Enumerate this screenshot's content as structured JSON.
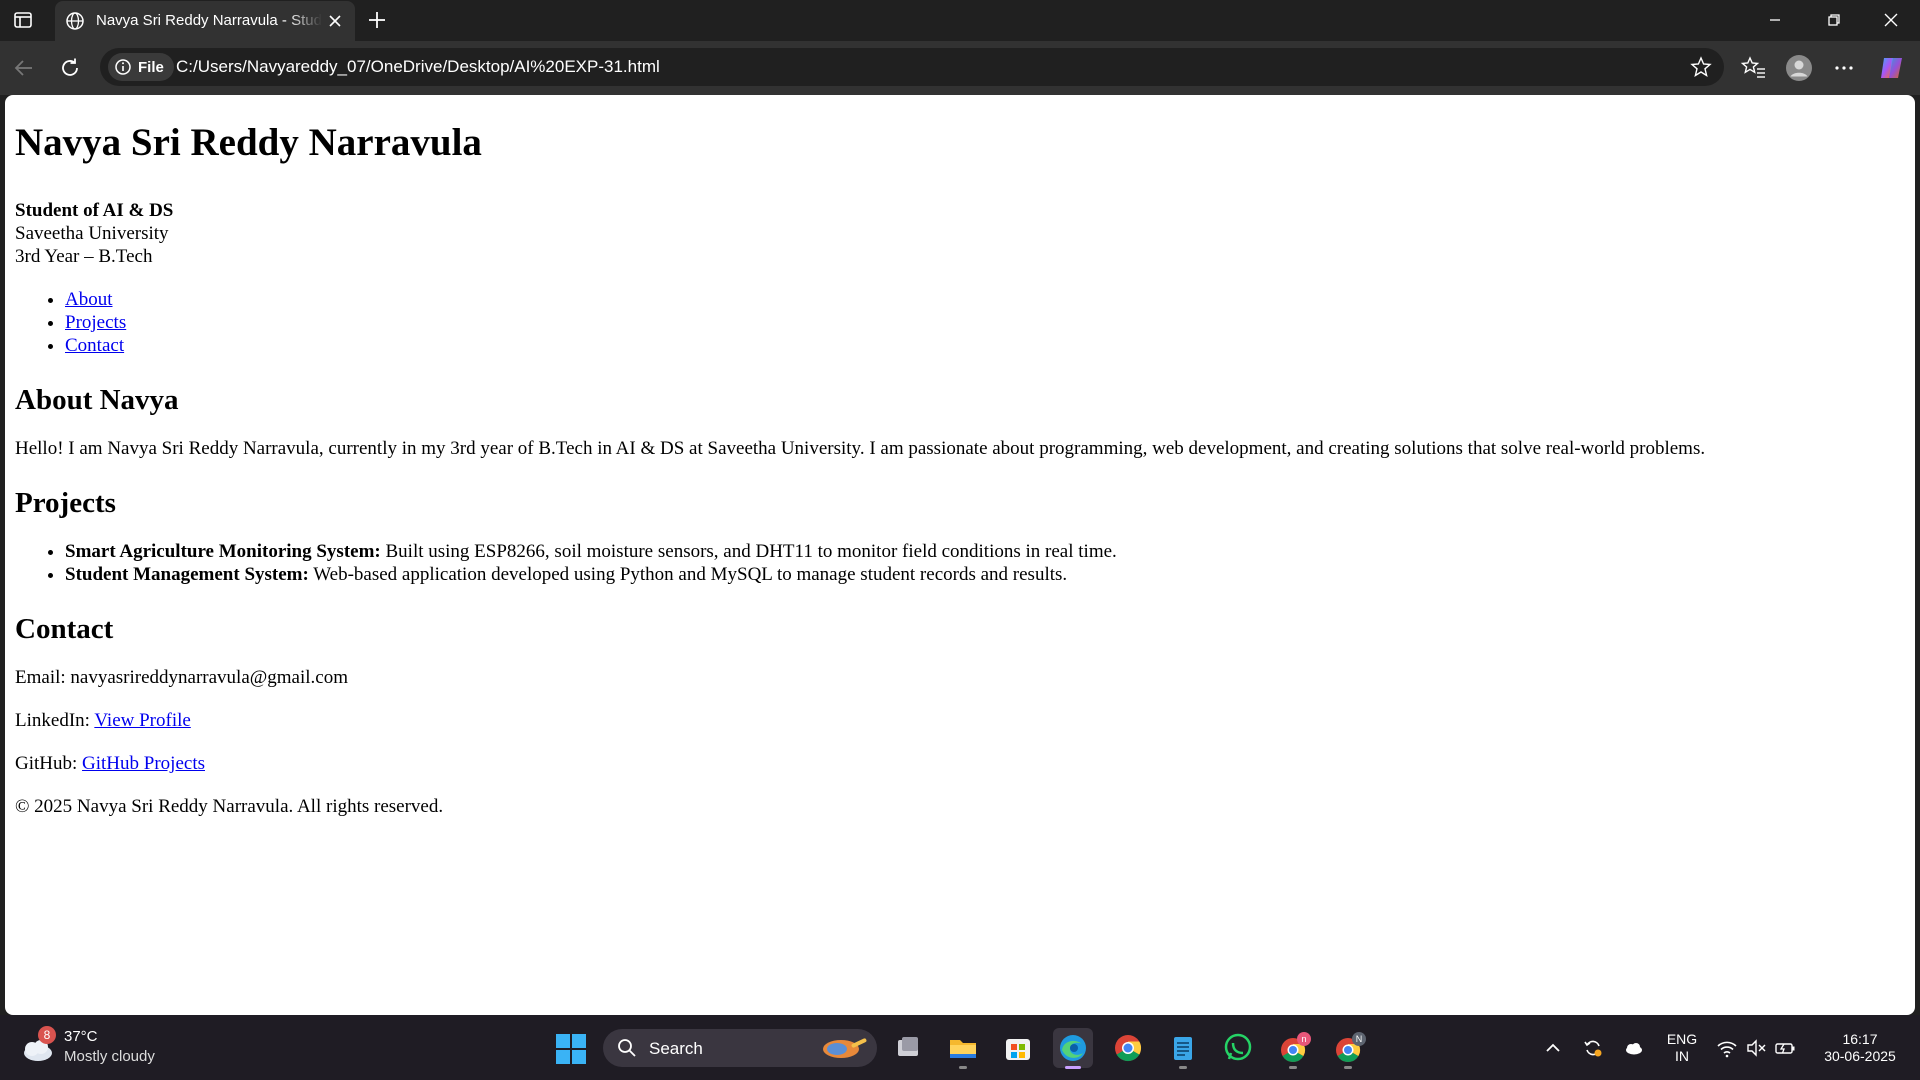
{
  "browser": {
    "tab_title": "Navya Sri Reddy Narravula - Student",
    "address_prefix": "File",
    "url": "C:/Users/Navyareddy_07/OneDrive/Desktop/AI%20EXP-31.html"
  },
  "page": {
    "name": "Navya Sri Reddy Narravula",
    "role": "Student of AI & DS",
    "university": "Saveetha University",
    "year": "3rd Year – B.Tech",
    "nav": [
      "About",
      "Projects",
      "Contact"
    ],
    "about": {
      "heading": "About Navya",
      "text": "Hello! I am Navya Sri Reddy Narravula, currently in my 3rd year of B.Tech in AI & DS at Saveetha University. I am passionate about programming, web development, and creating solutions that solve real-world problems."
    },
    "projects": {
      "heading": "Projects",
      "items": [
        {
          "title": "Smart Agriculture Monitoring System:",
          "desc": " Built using ESP8266, soil moisture sensors, and DHT11 to monitor field conditions in real time."
        },
        {
          "title": "Student Management System:",
          "desc": " Web-based application developed using Python and MySQL to manage student records and results."
        }
      ]
    },
    "contact": {
      "heading": "Contact",
      "email_label": "Email: ",
      "email": "navyasrireddynarravula@gmail.com",
      "linkedin_label": "LinkedIn: ",
      "linkedin_link": "View Profile",
      "github_label": "GitHub: ",
      "github_link": "GitHub Projects"
    },
    "footer": "© 2025 Navya Sri Reddy Narravula. All rights reserved."
  },
  "taskbar": {
    "weather_badge": "8",
    "temperature": "37°C",
    "condition": "Mostly cloudy",
    "search_label": "Search",
    "lang_top": "ENG",
    "lang_bottom": "IN",
    "time": "16:17",
    "date": "30-06-2025",
    "chrome_badge_1": "n",
    "chrome_badge_2": "N"
  },
  "colors": {
    "link": "#0000ee",
    "edge_accent": "#c9a0ff"
  }
}
